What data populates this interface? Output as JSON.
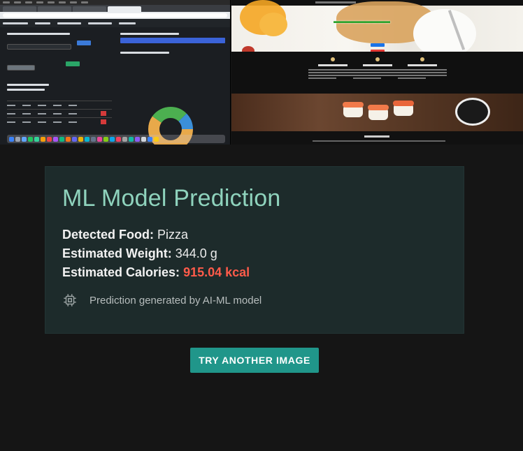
{
  "card": {
    "title": "ML Model Prediction",
    "detected_food": {
      "label": "Detected Food:",
      "value": "Pizza"
    },
    "estimated_weight": {
      "label": "Estimated Weight:",
      "value": "344.0 g"
    },
    "estimated_calories": {
      "label": "Estimated Calories:",
      "value": "915.04 kcal"
    },
    "note_icon": "chip-icon",
    "note": "Prediction generated by AI-ML model"
  },
  "actions": {
    "try_another_label": "TRY ANOTHER IMAGE"
  },
  "colors": {
    "page_background": "#151515",
    "card_background": "#1d2b2b",
    "title": "#8fd3bd",
    "calories": "#ff5b4a",
    "button": "#20968a"
  }
}
